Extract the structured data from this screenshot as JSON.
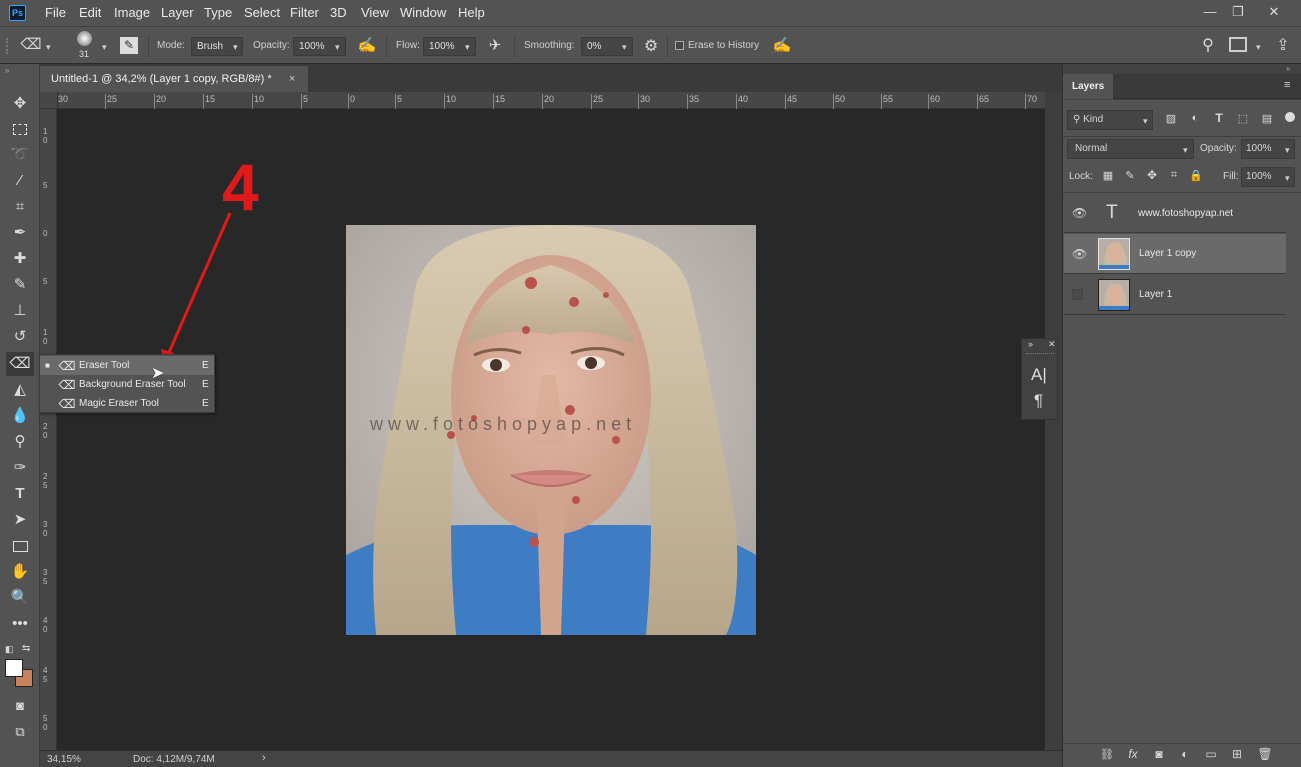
{
  "app": {
    "logo": "Ps"
  },
  "menu": [
    "File",
    "Edit",
    "Image",
    "Layer",
    "Type",
    "Select",
    "Filter",
    "3D",
    "View",
    "Window",
    "Help"
  ],
  "window_controls": {
    "minimize": "—",
    "restore": "❐",
    "close": "✕"
  },
  "options": {
    "brush_size": "31",
    "mode_label": "Mode:",
    "mode_value": "Brush",
    "opacity_label": "Opacity:",
    "opacity_value": "100%",
    "flow_label": "Flow:",
    "flow_value": "100%",
    "smoothing_label": "Smoothing:",
    "smoothing_value": "0%",
    "erase_history_label": "Erase to History"
  },
  "document": {
    "tab_title": "Untitled-1 @ 34,2% (Layer 1 copy, RGB/8#) *",
    "tab_close": "×",
    "zoom": "34,15%",
    "doc_info": "Doc: 4,12M/9,74M",
    "watermark": "www.fotoshopyap.net",
    "annotation": "4"
  },
  "ruler_top": [
    "30",
    "25",
    "20",
    "15",
    "10",
    "5",
    "0",
    "5",
    "10",
    "15",
    "20",
    "25",
    "30",
    "35",
    "40",
    "45",
    "50",
    "55",
    "60",
    "65",
    "70"
  ],
  "ruler_left": [
    "1\n0",
    "5",
    "0",
    "5",
    "1\n0",
    "1\n5",
    "2\n0",
    "2\n5",
    "3\n0",
    "3\n5",
    "4\n0",
    "4\n5",
    "5\n0"
  ],
  "flyout": [
    {
      "name": "Eraser Tool",
      "key": "E",
      "icon": "eraser-icon",
      "active": true
    },
    {
      "name": "Background Eraser Tool",
      "key": "E",
      "icon": "background-eraser-icon",
      "active": false
    },
    {
      "name": "Magic Eraser Tool",
      "key": "E",
      "icon": "magic-eraser-icon",
      "active": false
    }
  ],
  "layers_panel": {
    "title": "Layers",
    "filter_kind": "Kind",
    "blend_mode": "Normal",
    "opacity_label": "Opacity:",
    "opacity_value": "100%",
    "lock_label": "Lock:",
    "fill_label": "Fill:",
    "fill_value": "100%",
    "layers": [
      {
        "name": "www.fotoshopyap.net",
        "type": "text",
        "visible": true,
        "selected": false
      },
      {
        "name": "Layer 1 copy",
        "type": "image",
        "visible": true,
        "selected": true
      },
      {
        "name": "Layer 1",
        "type": "image",
        "visible": false,
        "selected": false
      }
    ]
  },
  "colors": {
    "accent": "#31a8ff",
    "annotation_red": "#e01a1a",
    "bg_panel": "#535353",
    "bg_canvas": "#282828",
    "foreground": "#ffffff",
    "background": "#c8825f"
  }
}
